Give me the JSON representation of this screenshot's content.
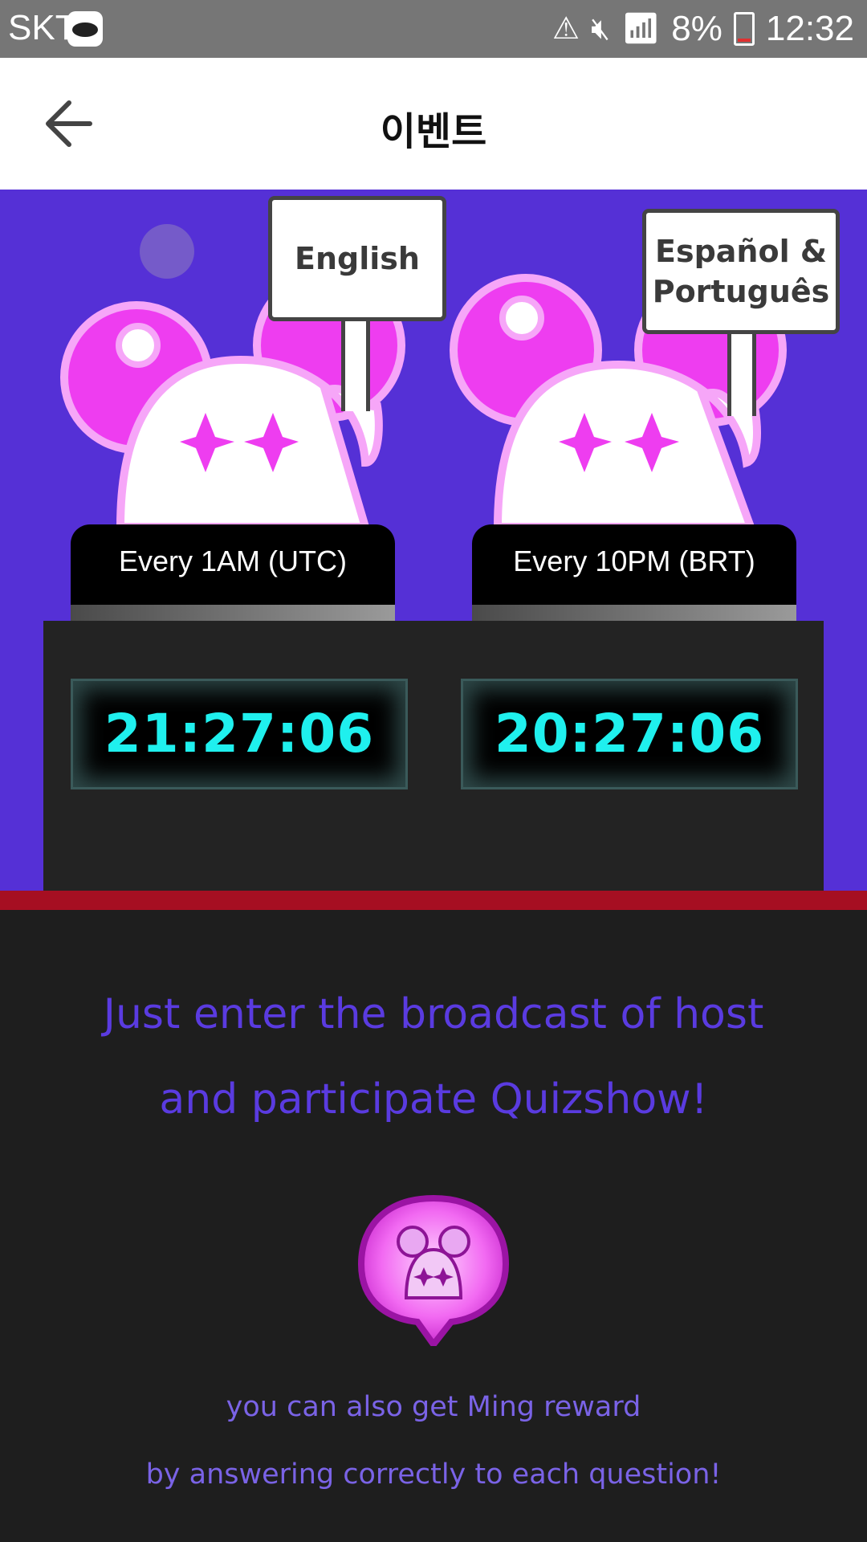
{
  "status_bar": {
    "carrier": "SKT",
    "battery": "8%",
    "time": "12:32"
  },
  "app_bar": {
    "title": "이벤트",
    "back_icon": "arrow-left-icon"
  },
  "stage": {
    "sign_english": "English",
    "sign_spanish_line1": "Español &",
    "sign_spanish_line2": "Português",
    "schedule_left": "Every 1AM (UTC)",
    "schedule_right": "Every 10PM (BRT)",
    "countdown_left": "21:27:06",
    "countdown_right": "20:27:06"
  },
  "content": {
    "headline_line1": "Just enter the broadcast of host",
    "headline_line2": "and participate Quizshow!",
    "reward_line1": "you can also get Ming reward",
    "reward_line2": "by answering correctly to each question!"
  },
  "colors": {
    "stage_bg": "#5530d6",
    "accent_magenta": "#ee3df0",
    "clock_cyan": "#1ff0ee",
    "headline": "#5a3be0",
    "divider_red": "#a60f22"
  }
}
